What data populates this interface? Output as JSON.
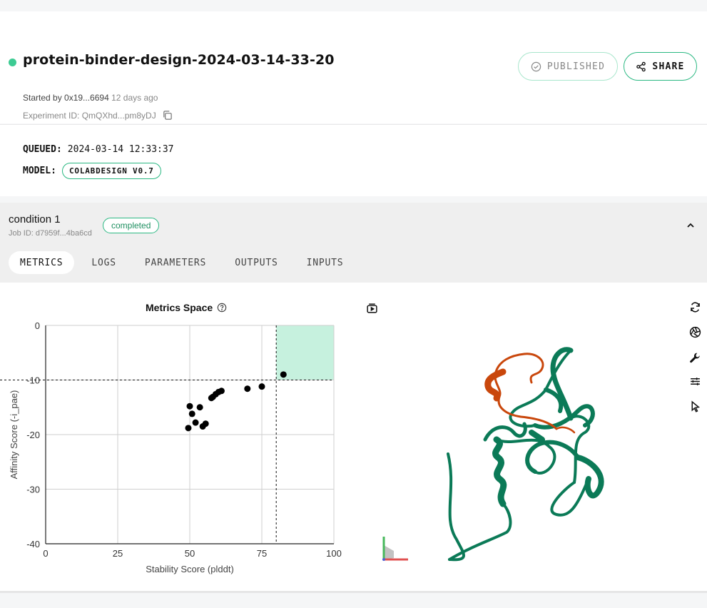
{
  "header": {
    "title": "protein-binder-design-2024-03-14-33-20",
    "started_by_label": "Started by 0x19...6694",
    "started_ago": "12 days ago",
    "experiment_id": "Experiment ID: QmQXhd...pm8yDJ",
    "published_label": "PUBLISHED",
    "share_label": "SHARE",
    "status_color": "#3dcb93"
  },
  "info": {
    "queued_label": "QUEUED:",
    "queued_value": "2024-03-14 12:33:37",
    "model_label": "MODEL:",
    "model_value": "COLABDESIGN V0.7"
  },
  "condition": {
    "name": "condition 1",
    "job_id": "Job ID: d7959f...4ba6cd",
    "status": "completed",
    "tabs": [
      {
        "label": "METRICS",
        "active": true
      },
      {
        "label": "LOGS",
        "active": false
      },
      {
        "label": "PARAMETERS",
        "active": false
      },
      {
        "label": "OUTPUTS",
        "active": false
      },
      {
        "label": "INPUTS",
        "active": false
      }
    ]
  },
  "chart_data": {
    "type": "scatter",
    "title": "Metrics Space",
    "xlabel": "Stability Score (plddt)",
    "ylabel": "Affinity Score (-i_pae)",
    "xlim": [
      0,
      100
    ],
    "ylim": [
      -40,
      0
    ],
    "xticks": [
      0,
      25,
      50,
      75,
      100
    ],
    "yticks": [
      0,
      -10,
      -20,
      -30,
      -40
    ],
    "grid": true,
    "threshold": {
      "x": 80,
      "y": -10
    },
    "highlight_color": "#c6f1de",
    "points": [
      {
        "x": 82.5,
        "y": -9.0
      },
      {
        "x": 75.0,
        "y": -11.2
      },
      {
        "x": 70.0,
        "y": -11.6
      },
      {
        "x": 61.0,
        "y": -12.0
      },
      {
        "x": 60.0,
        "y": -12.2
      },
      {
        "x": 59.0,
        "y": -12.6
      },
      {
        "x": 58.0,
        "y": -13.1
      },
      {
        "x": 57.5,
        "y": -13.3
      },
      {
        "x": 53.5,
        "y": -15.0
      },
      {
        "x": 50.0,
        "y": -14.8
      },
      {
        "x": 50.8,
        "y": -16.2
      },
      {
        "x": 52.0,
        "y": -17.8
      },
      {
        "x": 55.5,
        "y": -18.0
      },
      {
        "x": 54.5,
        "y": -18.5
      },
      {
        "x": 49.5,
        "y": -18.8
      }
    ]
  },
  "viewer": {
    "icons": [
      "snapshot-icon",
      "rotate-icon",
      "aperture-icon",
      "wrench-icon",
      "sliders-icon",
      "cursor-icon"
    ],
    "chain_colors": {
      "binder": "#0b7a57",
      "target": "#c9470c"
    }
  }
}
